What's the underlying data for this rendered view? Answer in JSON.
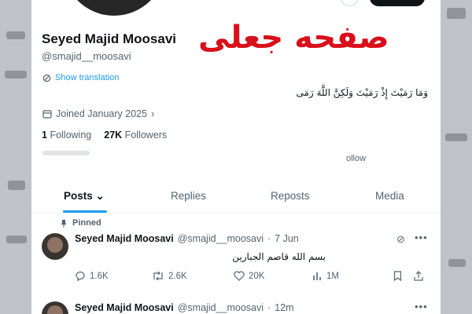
{
  "overlay_text": "صفحه جعلی",
  "profile": {
    "display_name": "Seyed Majid Moosavi",
    "handle": "@smajid__moosavi",
    "show_translation": "Show translation",
    "bio": "وَمَا رَمَيْتَ إِذْ رَمَيْتَ وَلَكِنَّ اللَّهَ رَمَى",
    "joined": "Joined January 2025",
    "following_count": "1",
    "following_label": "Following",
    "followers_count": "27K",
    "followers_label": "Followers",
    "follow_fragment": "ollow"
  },
  "tabs": [
    "Posts",
    "Replies",
    "Reposts",
    "Media"
  ],
  "tweets": [
    {
      "pinned_label": "Pinned",
      "name": "Seyed Majid Moosavi",
      "handle": "@smajid__moosavi",
      "separator": "·",
      "time": "7 Jun",
      "text": "بسم الله قاصم الجبارین",
      "replies": "1.6K",
      "reposts": "2.6K",
      "likes": "20K",
      "views": "1M"
    },
    {
      "name": "Seyed Majid Moosavi",
      "handle": "@smajid__moosavi",
      "separator": "·",
      "time": "12m"
    }
  ],
  "colors": {
    "accent": "#1d9bf0",
    "overlay": "#d90f1a",
    "text": "#0f1419",
    "muted": "#536471"
  },
  "icons": [
    "calendar-icon",
    "translate-icon",
    "pin-icon",
    "chevron-down-icon",
    "reply-icon",
    "repost-icon",
    "like-icon",
    "views-icon",
    "bookmark-icon",
    "share-icon",
    "grok-icon",
    "more-icon"
  ]
}
